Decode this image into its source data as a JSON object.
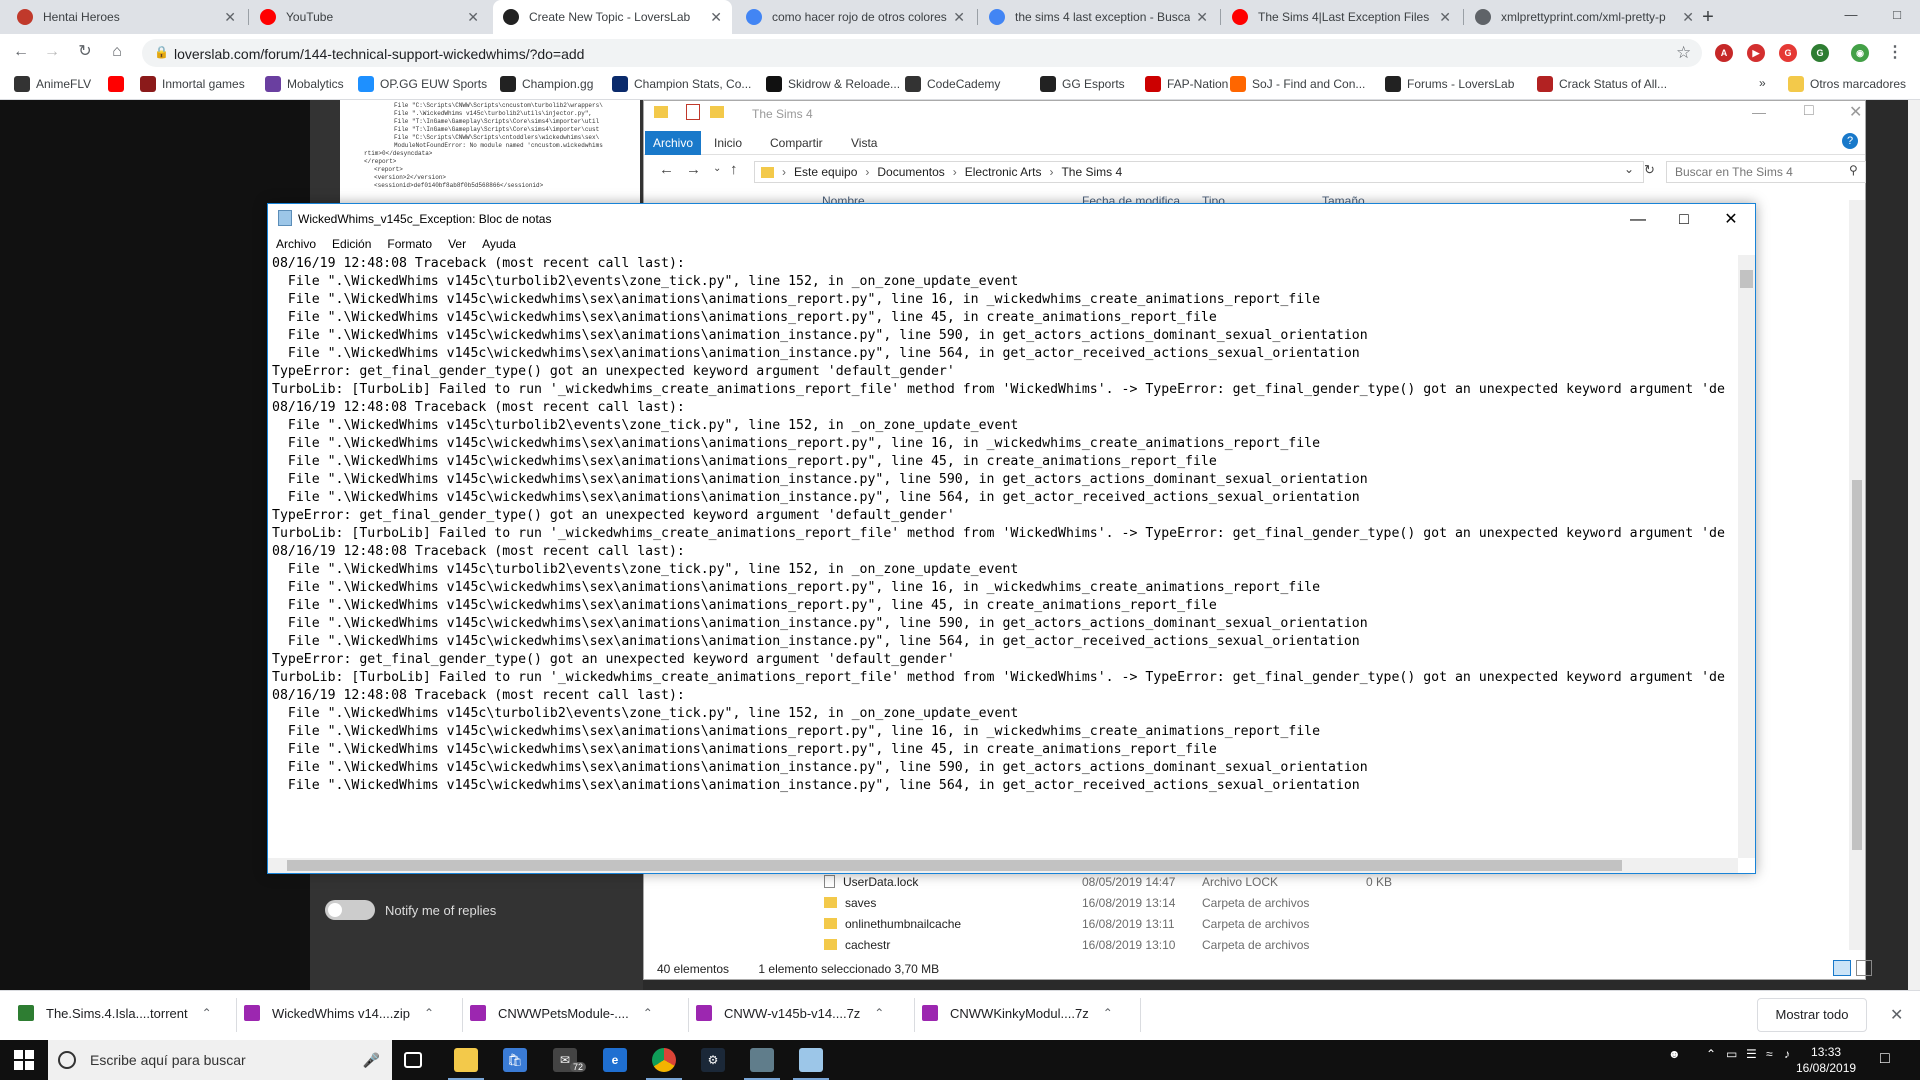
{
  "chrome": {
    "tabs": [
      {
        "title": "Hentai Heroes",
        "color": "#c0392b"
      },
      {
        "title": "YouTube",
        "color": "#ff0000"
      },
      {
        "title": "Create New Topic - LoversLab",
        "color": "#222222"
      },
      {
        "title": "como hacer rojo de otros colores",
        "color": "#4285f4"
      },
      {
        "title": "the sims 4 last exception - Buscar",
        "color": "#4285f4"
      },
      {
        "title": "The Sims 4|Last Exception Files an",
        "color": "#ff0000"
      },
      {
        "title": "xmlprettyprint.com/xml-pretty-p",
        "color": "#5f6368"
      }
    ],
    "url": "loverslab.com/forum/144-technical-support-wickedwhims/?do=add",
    "bookmarks": [
      {
        "label": "AnimeFLV",
        "color": "#333333"
      },
      {
        "label": "",
        "color": "#ff0000"
      },
      {
        "label": "Inmortal games",
        "color": "#8b1a1a"
      },
      {
        "label": "Mobalytics",
        "color": "#6a3fa0"
      },
      {
        "label": "OP.GG EUW Sports",
        "color": "#1e90ff"
      },
      {
        "label": "Champion.gg",
        "color": "#222222"
      },
      {
        "label": "Champion Stats, Co...",
        "color": "#0a2a6b"
      },
      {
        "label": "Skidrow & Reloade...",
        "color": "#111111"
      },
      {
        "label": "CodeCademy",
        "color": "#333333"
      },
      {
        "label": "GG Esports",
        "color": "#222222"
      },
      {
        "label": "FAP-Nation",
        "color": "#cc0000"
      },
      {
        "label": "SoJ - Find and Con...",
        "color": "#ff6600"
      },
      {
        "label": "Forums - LoversLab",
        "color": "#222222"
      },
      {
        "label": "Crack Status of All...",
        "color": "#b22222"
      }
    ],
    "bookmarks_more": "»",
    "other_bookmarks": "Otros marcadores"
  },
  "forum": {
    "notify_label": "Notify me of replies",
    "xml_lines": [
      "File \"C:\\Scripts\\CNWW\\Scripts\\cncustom\\turbolib2\\wrappers\\",
      "File \".\\WickedWhims v145c\\turbolib2\\utils\\injector.py\",",
      "File \"T:\\InGame\\Gameplay\\Scripts\\Core\\sims4\\importer\\util",
      "File \"T:\\InGame\\Gameplay\\Scripts\\Core\\sims4\\importer\\cust",
      "File \"C:\\Scripts\\CNWW\\Scripts\\cntoddlers\\wickedwhims\\sex\\",
      "ModuleNotFoundError: No module named 'cncustom.wickedwhims",
      "rtim>0</desyncdata>",
      "</report>",
      "<report>",
      "<version>2</version>",
      "<sessionid>def0140bf8ab8f0b5d568866</sessionid>"
    ]
  },
  "explorer": {
    "title": "The Sims 4",
    "ribbon_tabs": [
      "Archivo",
      "Inicio",
      "Compartir",
      "Vista"
    ],
    "path": [
      "Este equipo",
      "Documentos",
      "Electronic Arts",
      "The Sims 4"
    ],
    "search_placeholder": "Buscar en The Sims 4",
    "columns": [
      "Nombre",
      "Fecha de modifica...",
      "Tipo",
      "Tamaño"
    ],
    "rows": [
      {
        "name": "UserData.lock",
        "date": "08/05/2019 14:47",
        "type": "Archivo LOCK",
        "size": "0 KB",
        "kind": "file"
      },
      {
        "name": "saves",
        "date": "16/08/2019 13:14",
        "type": "Carpeta de archivos",
        "size": "",
        "kind": "folder"
      },
      {
        "name": "onlinethumbnailcache",
        "date": "16/08/2019 13:11",
        "type": "Carpeta de archivos",
        "size": "",
        "kind": "folder"
      },
      {
        "name": "cachestr",
        "date": "16/08/2019 13:10",
        "type": "Carpeta de archivos",
        "size": "",
        "kind": "folder"
      }
    ],
    "status_count": "40 elementos",
    "status_selected": "1 elemento seleccionado  3,70 MB"
  },
  "notepad": {
    "title": "WickedWhims_v145c_Exception: Bloc de notas",
    "menu": [
      "Archivo",
      "Edición",
      "Formato",
      "Ver",
      "Ayuda"
    ],
    "lines": [
      "08/16/19 12:48:08 Traceback (most recent call last):",
      "  File \".\\WickedWhims v145c\\turbolib2\\events\\zone_tick.py\", line 152, in _on_zone_update_event",
      "  File \".\\WickedWhims v145c\\wickedwhims\\sex\\animations\\animations_report.py\", line 16, in _wickedwhims_create_animations_report_file",
      "  File \".\\WickedWhims v145c\\wickedwhims\\sex\\animations\\animations_report.py\", line 45, in create_animations_report_file",
      "  File \".\\WickedWhims v145c\\wickedwhims\\sex\\animations\\animation_instance.py\", line 590, in get_actors_actions_dominant_sexual_orientation",
      "  File \".\\WickedWhims v145c\\wickedwhims\\sex\\animations\\animation_instance.py\", line 564, in get_actor_received_actions_sexual_orientation",
      "TypeError: get_final_gender_type() got an unexpected keyword argument 'default_gender'",
      "TurboLib: [TurboLib] Failed to run '_wickedwhims_create_animations_report_file' method from 'WickedWhims'. -> TypeError: get_final_gender_type() got an unexpected keyword argument 'de",
      "",
      "08/16/19 12:48:08 Traceback (most recent call last):",
      "  File \".\\WickedWhims v145c\\turbolib2\\events\\zone_tick.py\", line 152, in _on_zone_update_event",
      "  File \".\\WickedWhims v145c\\wickedwhims\\sex\\animations\\animations_report.py\", line 16, in _wickedwhims_create_animations_report_file",
      "  File \".\\WickedWhims v145c\\wickedwhims\\sex\\animations\\animations_report.py\", line 45, in create_animations_report_file",
      "  File \".\\WickedWhims v145c\\wickedwhims\\sex\\animations\\animation_instance.py\", line 590, in get_actors_actions_dominant_sexual_orientation",
      "  File \".\\WickedWhims v145c\\wickedwhims\\sex\\animations\\animation_instance.py\", line 564, in get_actor_received_actions_sexual_orientation",
      "TypeError: get_final_gender_type() got an unexpected keyword argument 'default_gender'",
      "TurboLib: [TurboLib] Failed to run '_wickedwhims_create_animations_report_file' method from 'WickedWhims'. -> TypeError: get_final_gender_type() got an unexpected keyword argument 'de",
      "",
      "08/16/19 12:48:08 Traceback (most recent call last):",
      "  File \".\\WickedWhims v145c\\turbolib2\\events\\zone_tick.py\", line 152, in _on_zone_update_event",
      "  File \".\\WickedWhims v145c\\wickedwhims\\sex\\animations\\animations_report.py\", line 16, in _wickedwhims_create_animations_report_file",
      "  File \".\\WickedWhims v145c\\wickedwhims\\sex\\animations\\animations_report.py\", line 45, in create_animations_report_file",
      "  File \".\\WickedWhims v145c\\wickedwhims\\sex\\animations\\animation_instance.py\", line 590, in get_actors_actions_dominant_sexual_orientation",
      "  File \".\\WickedWhims v145c\\wickedwhims\\sex\\animations\\animation_instance.py\", line 564, in get_actor_received_actions_sexual_orientation",
      "TypeError: get_final_gender_type() got an unexpected keyword argument 'default_gender'",
      "TurboLib: [TurboLib] Failed to run '_wickedwhims_create_animations_report_file' method from 'WickedWhims'. -> TypeError: get_final_gender_type() got an unexpected keyword argument 'de",
      "",
      "08/16/19 12:48:08 Traceback (most recent call last):",
      "  File \".\\WickedWhims v145c\\turbolib2\\events\\zone_tick.py\", line 152, in _on_zone_update_event",
      "  File \".\\WickedWhims v145c\\wickedwhims\\sex\\animations\\animations_report.py\", line 16, in _wickedwhims_create_animations_report_file",
      "  File \".\\WickedWhims v145c\\wickedwhims\\sex\\animations\\animations_report.py\", line 45, in create_animations_report_file",
      "  File \".\\WickedWhims v145c\\wickedwhims\\sex\\animations\\animation_instance.py\", line 590, in get_actors_actions_dominant_sexual_orientation",
      "  File \".\\WickedWhims v145c\\wickedwhims\\sex\\animations\\animation_instance.py\", line 564, in get_actor_received_actions_sexual_orientation"
    ]
  },
  "downloads": {
    "items": [
      {
        "name": "The.Sims.4.Isla....torrent",
        "color": "#2e7d32"
      },
      {
        "name": "WickedWhims v14....zip",
        "color": "#9c27b0"
      },
      {
        "name": "CNWWPetsModule-....",
        "color": "#9c27b0"
      },
      {
        "name": "CNWW-v145b-v14....7z",
        "color": "#9c27b0"
      },
      {
        "name": "CNWWKinkyModul....7z",
        "color": "#9c27b0"
      }
    ],
    "show_all": "Mostrar todo"
  },
  "taskbar": {
    "search_placeholder": "Escribe aquí para buscar",
    "mail_badge": "72",
    "time": "13:33",
    "date": "16/08/2019"
  }
}
